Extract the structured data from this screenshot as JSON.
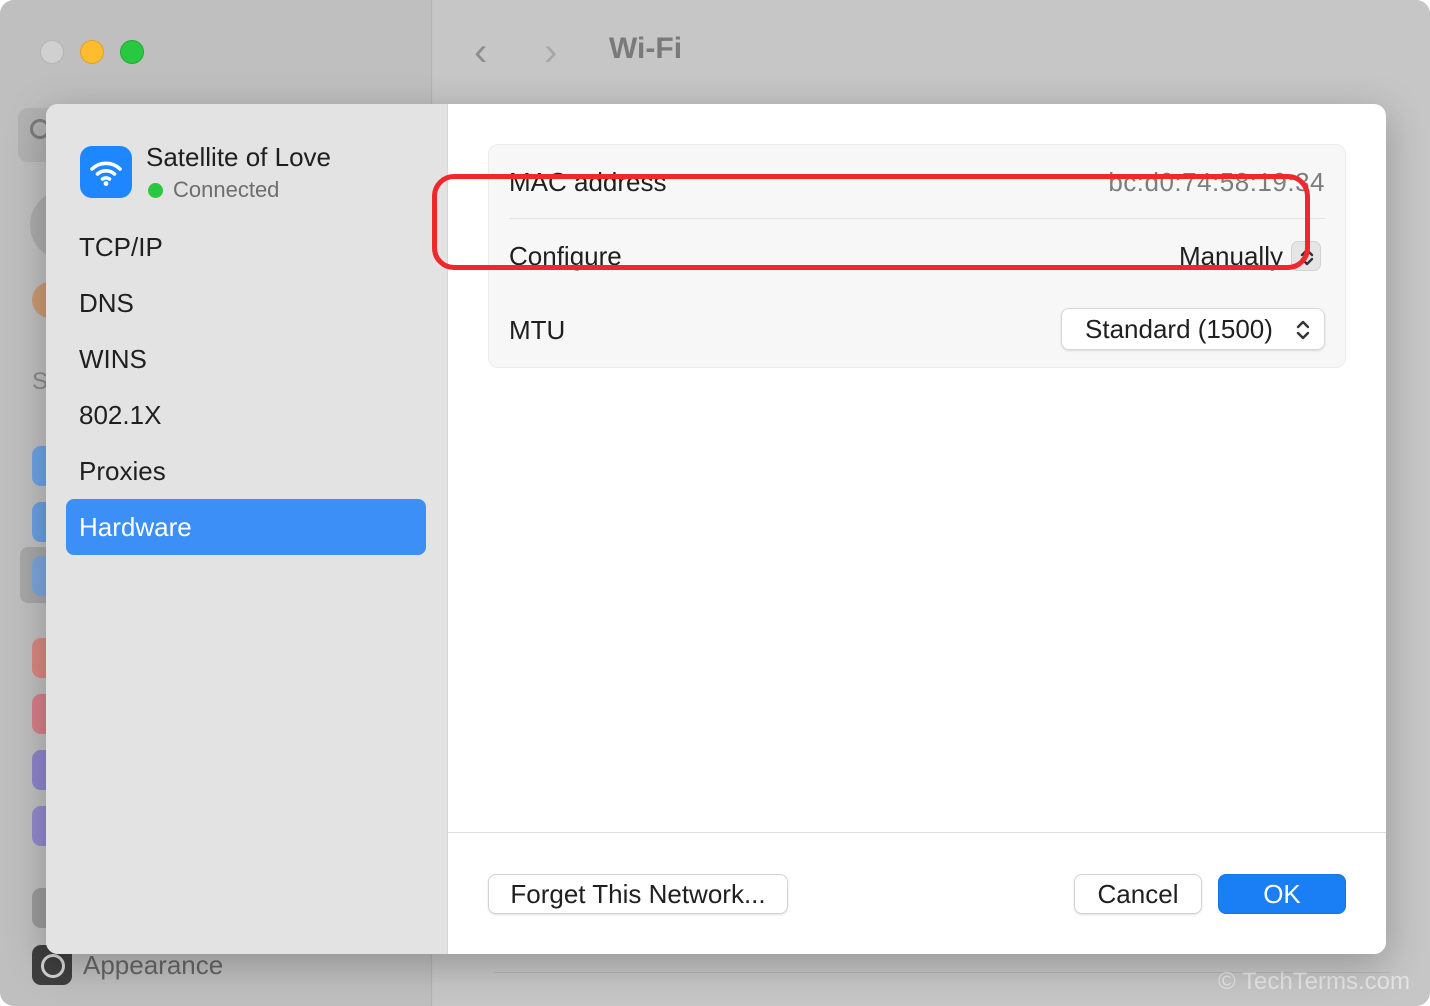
{
  "background_window": {
    "title": "Wi-Fi",
    "back_glyph": "‹",
    "forward_glyph": "›",
    "section_letter": "S",
    "appearance_label": "Appearance"
  },
  "sheet": {
    "network": {
      "name": "Satellite of Love",
      "status": "Connected",
      "icon": "wifi-icon"
    },
    "sidebar": {
      "items": [
        {
          "label": "TCP/IP",
          "selected": false
        },
        {
          "label": "DNS",
          "selected": false
        },
        {
          "label": "WINS",
          "selected": false
        },
        {
          "label": "802.1X",
          "selected": false
        },
        {
          "label": "Proxies",
          "selected": false
        },
        {
          "label": "Hardware",
          "selected": true
        }
      ]
    },
    "hardware": {
      "mac_label": "MAC address",
      "mac_value": "bc:d0:74:58:19:34",
      "configure_label": "Configure",
      "configure_value": "Manually",
      "mtu_label": "MTU",
      "mtu_value": "Standard (1500)"
    },
    "buttons": {
      "forget": "Forget This Network...",
      "cancel": "Cancel",
      "ok": "OK"
    }
  },
  "watermark": "© TechTerms.com",
  "colors": {
    "accent": "#1a7ff5",
    "selection": "#3b8ff6",
    "highlight": "#f0282b",
    "connected": "#28c840"
  }
}
